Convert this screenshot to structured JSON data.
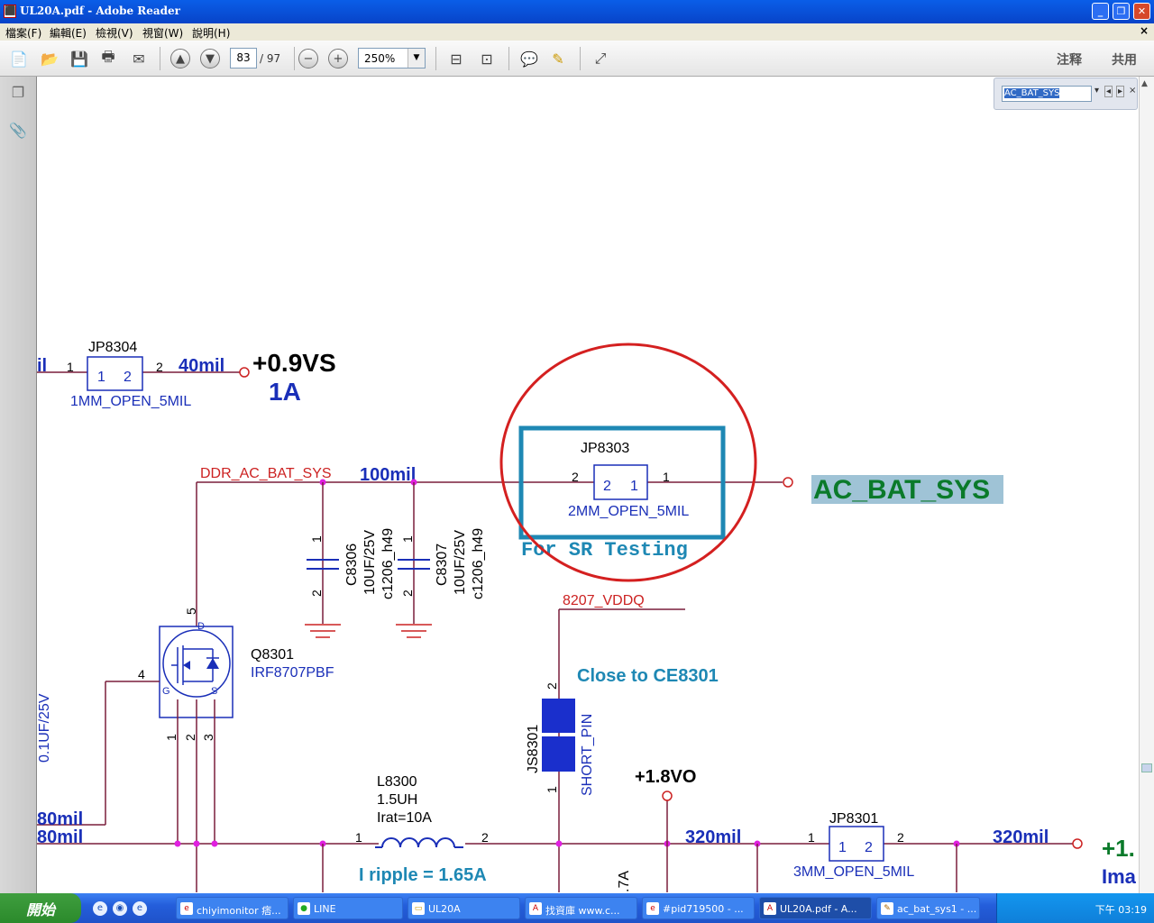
{
  "window": {
    "title": "UL20A.pdf - Adobe Reader",
    "icon": "pdf-icon"
  },
  "menu": [
    "檔案(F)",
    "編輯(E)",
    "檢視(V)",
    "視窗(W)",
    "說明(H)"
  ],
  "toolbar": {
    "page_current": "83",
    "page_total": "/ 97",
    "zoom": "250%",
    "comment_label": "注释",
    "share_label": "共用"
  },
  "find": {
    "value": "AC_BAT_SYS"
  },
  "schematic": {
    "jp8304": {
      "ref": "JP8304",
      "pins": [
        "1",
        "2"
      ],
      "pin_left": "1",
      "pin_right": "2",
      "package": "1MM_OPEN_5MIL",
      "net_left": "il",
      "width": "40mil",
      "rail": "+0.9VS",
      "current": "1A"
    },
    "ddr_net": "DDR_AC_BAT_SYS",
    "width_100": "100mil",
    "jp8303": {
      "ref": "JP8303",
      "pins": [
        "2",
        "1"
      ],
      "pin_left": "2",
      "pin_right": "1",
      "package": "2MM_OPEN_5MIL",
      "note": "For SR Testing"
    },
    "ac_bat_sys": "AC_BAT_SYS",
    "c8306": {
      "ref": "C8306",
      "value": "10UF/25V",
      "footprint": "c1206_h49",
      "pin1": "1",
      "pin2": "2"
    },
    "c8307": {
      "ref": "C8307",
      "value": "10UF/25V",
      "footprint": "c1206_h49",
      "pin1": "1",
      "pin2": "2"
    },
    "vddq_net": "8207_VDDQ",
    "close_note": "Close to CE8301",
    "js8301": {
      "ref": "JS8301",
      "type": "SHORT_PIN",
      "pin_top": "2",
      "pin_bottom": "1"
    },
    "q8301": {
      "ref": "Q8301",
      "part": "IRF8707PBF",
      "pin5": "5",
      "pin4": "4",
      "pin_d": "D",
      "pin_g": "G",
      "pin_s": "S",
      "pins_bottom": [
        "1",
        "2",
        "3"
      ]
    },
    "left_cap": "0.1UF/25V",
    "width_80a": "80mil",
    "width_80b": "80mil",
    "l8300": {
      "ref": "L8300",
      "value": "1.5UH",
      "irat": "Irat=10A",
      "pin1": "1",
      "pin2": "2"
    },
    "ripple": "I ripple = 1.65A",
    "rail_18vo": "+1.8VO",
    "width_320a": "320mil",
    "jp8301": {
      "ref": "JP8301",
      "pins": [
        "1",
        "2"
      ],
      "pin_left": "1",
      "pin_right": "2",
      "package": "3MM_OPEN_5MIL"
    },
    "width_320b": "320mil",
    "partial_rail": "+1.",
    "partial_ima": "Ima",
    "partial_7a": ".7A"
  },
  "taskbar": {
    "start": "開始",
    "tasks": [
      "chiyimonitor 痞...",
      "LINE",
      "UL20A",
      "找資庫 www.c...",
      "#pid719500 - ...",
      "UL20A.pdf - A...",
      "ac_bat_sys1 - ..."
    ],
    "clock": "下午 03:19"
  },
  "colors": {
    "wire": "#7a1f3c",
    "net_blue": "#1a2fb8",
    "net_red": "#cc2222",
    "annotation_blue": "#1e88b4",
    "circle_red": "#d42020",
    "junction": "#e020e0",
    "ac_bat_green": "#0a7a2a",
    "highlight": "#9fc3d6"
  }
}
